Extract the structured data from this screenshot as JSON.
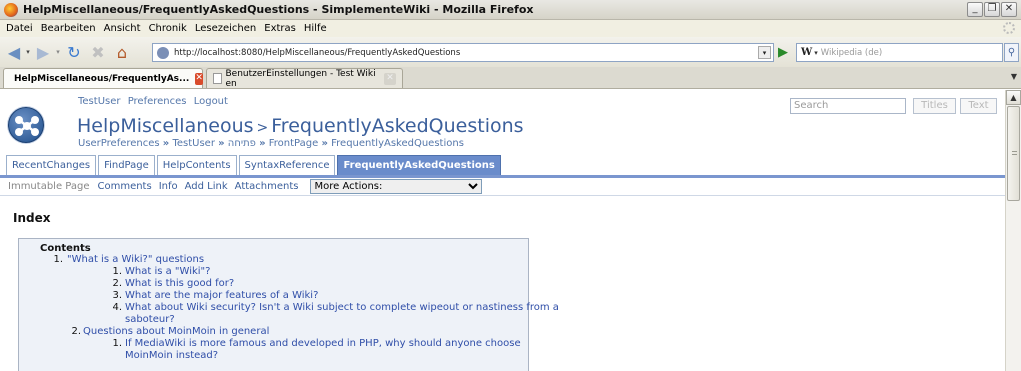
{
  "window": {
    "title": "HelpMiscellaneous/FrequentlyAskedQuestions - SimplementeWiki - Mozilla Firefox"
  },
  "menu": [
    "Datei",
    "Bearbeiten",
    "Ansicht",
    "Chronik",
    "Lesezeichen",
    "Extras",
    "Hilfe"
  ],
  "address": {
    "url": "http://localhost:8080/HelpMiscellaneous/FrequentlyAskedQuestions"
  },
  "browser_search": {
    "engine": "W",
    "placeholder": "Wikipedia (de)"
  },
  "tabs": [
    {
      "label": "HelpMiscellaneous/FrequentlyAs...",
      "active": true
    },
    {
      "label": "BenutzerEinstellungen - Test Wiki en",
      "active": false
    }
  ],
  "wiki": {
    "user_links": [
      "TestUser",
      "Preferences",
      "Logout"
    ],
    "title_parent": "HelpMiscellaneous",
    "title_sep": ">",
    "title_page": "FrequentlyAskedQuestions",
    "breadcrumbs": [
      "UserPreferences",
      "TestUser",
      "פתיחה",
      "FrontPage",
      "FrequentlyAskedQuestions"
    ],
    "crumb_sep": "»",
    "search_placeholder": "Search",
    "titles_btn": "Titles",
    "text_btn": "Text",
    "nav_tabs": [
      "RecentChanges",
      "FindPage",
      "HelpContents",
      "SyntaxReference",
      "FrequentlyAskedQuestions"
    ],
    "actions": {
      "immutable": "Immutable Page",
      "links": [
        "Comments",
        "Info",
        "Add Link",
        "Attachments"
      ],
      "more": "More Actions:"
    },
    "heading": "Index",
    "toc": {
      "title": "Contents",
      "items": [
        {
          "num": "1.",
          "text": "\"What is a Wiki?\" questions"
        },
        {
          "num": "1.",
          "text": "What is a \"Wiki\"?"
        },
        {
          "num": "2.",
          "text": "What is this good for?"
        },
        {
          "num": "3.",
          "text": "What are the major features of a Wiki?"
        },
        {
          "num": "4.",
          "text": "What about Wiki security? Isn't a Wiki subject to complete wipeout or nastiness from a"
        },
        {
          "num": "",
          "text": "saboteur?"
        },
        {
          "num": "2.",
          "text": "Questions about MoinMoin in general"
        },
        {
          "num": "1.",
          "text": "If MediaWiki is more famous and developed in PHP, why should anyone choose"
        },
        {
          "num": "",
          "text": "MoinMoin instead?"
        }
      ]
    }
  }
}
